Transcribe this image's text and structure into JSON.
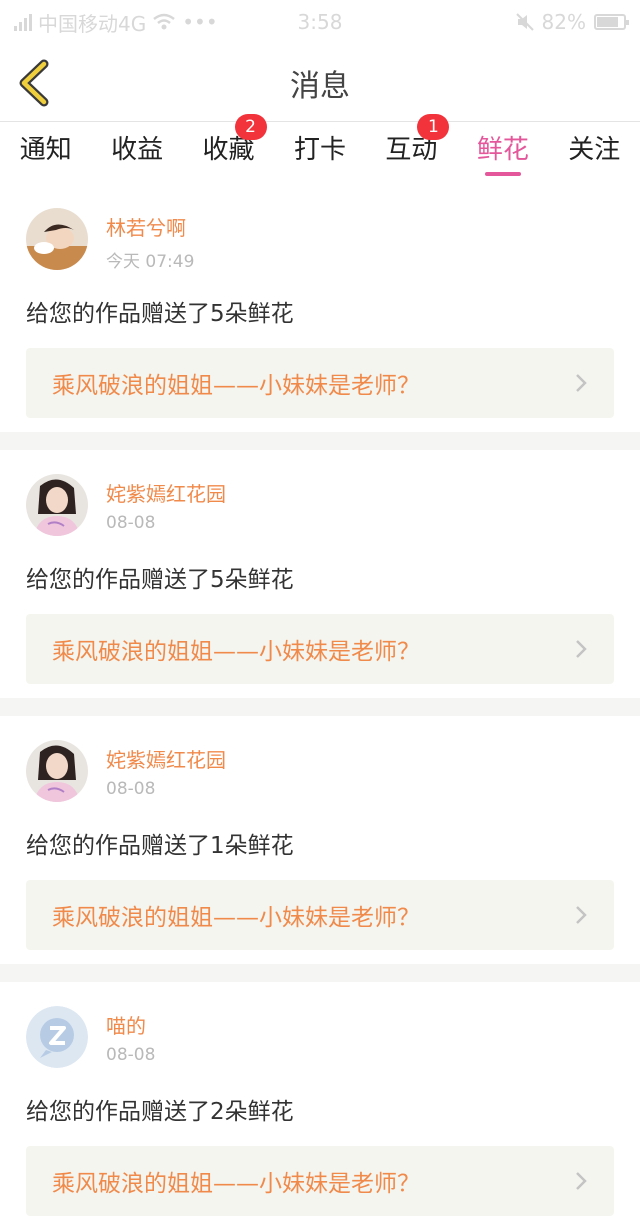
{
  "status_bar": {
    "carrier": "中国移动4G",
    "time": "3:58",
    "battery": "82%",
    "battery_level": 0.82
  },
  "header": {
    "title": "消息",
    "back_icon": "back-chevron-icon"
  },
  "tabs": [
    {
      "label": "通知",
      "badge": "",
      "active": false
    },
    {
      "label": "收益",
      "badge": "",
      "active": false
    },
    {
      "label": "收藏",
      "badge": "2",
      "active": false
    },
    {
      "label": "打卡",
      "badge": "",
      "active": false
    },
    {
      "label": "互动",
      "badge": "1",
      "active": false
    },
    {
      "label": "鲜花",
      "badge": "",
      "active": true
    },
    {
      "label": "关注",
      "badge": "",
      "active": false
    }
  ],
  "colors": {
    "accent_pink": "#e4579b",
    "name_orange": "#f08a4b",
    "badge_red": "#f2333b"
  },
  "messages": [
    {
      "username": "林若兮啊",
      "time": "今天 07:49",
      "text": "给您的作品赠送了5朵鲜花",
      "work_title": "乘风破浪的姐姐——小妹妹是老师？"
    },
    {
      "username": "姹紫嫣红花园",
      "time": "08-08",
      "text": "给您的作品赠送了5朵鲜花",
      "work_title": "乘风破浪的姐姐——小妹妹是老师？"
    },
    {
      "username": "姹紫嫣红花园",
      "time": "08-08",
      "text": "给您的作品赠送了1朵鲜花",
      "work_title": "乘风破浪的姐姐——小妹妹是老师？"
    },
    {
      "username": "喵的",
      "time": "08-08",
      "text": "给您的作品赠送了2朵鲜花",
      "work_title": "乘风破浪的姐姐——小妹妹是老师？"
    }
  ]
}
